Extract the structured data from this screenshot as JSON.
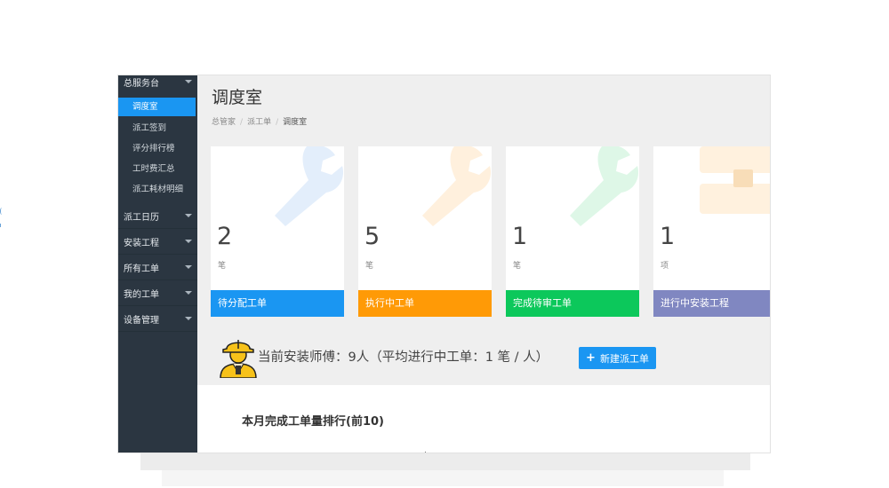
{
  "sidebar": {
    "groups": [
      {
        "label": "总服务台",
        "items": [
          "调度室",
          "派工签到",
          "评分排行榜",
          "工时费汇总",
          "派工耗材明细"
        ],
        "active_item": 0
      },
      {
        "label": "派工日历"
      },
      {
        "label": "安装工程"
      },
      {
        "label": "所有工单"
      },
      {
        "label": "我的工单"
      },
      {
        "label": "设备管理"
      }
    ]
  },
  "header": {
    "title": "调度室",
    "breadcrumb": [
      "总管家",
      "派工单",
      "调度室"
    ]
  },
  "cards": [
    {
      "value": "2",
      "unit": "笔",
      "label": "待分配工单",
      "color": "#1a96f2",
      "icon": "wrench-icon"
    },
    {
      "value": "5",
      "unit": "笔",
      "label": "执行中工单",
      "color": "#ff9a06",
      "icon": "wrench-icon"
    },
    {
      "value": "1",
      "unit": "笔",
      "label": "完成待审工单",
      "color": "#0cc85b",
      "icon": "wrench-icon"
    },
    {
      "value": "1",
      "unit": "项",
      "label": "进行中安装工程",
      "color": "#8087c1",
      "icon": "toolbox-icon"
    }
  ],
  "summary": {
    "text": "当前安装师傅：9人（平均进行中工单：1 笔 / 人）",
    "new_button": "新建派工单"
  },
  "ranking": {
    "title": "本月完成工单量排行(前10)"
  }
}
